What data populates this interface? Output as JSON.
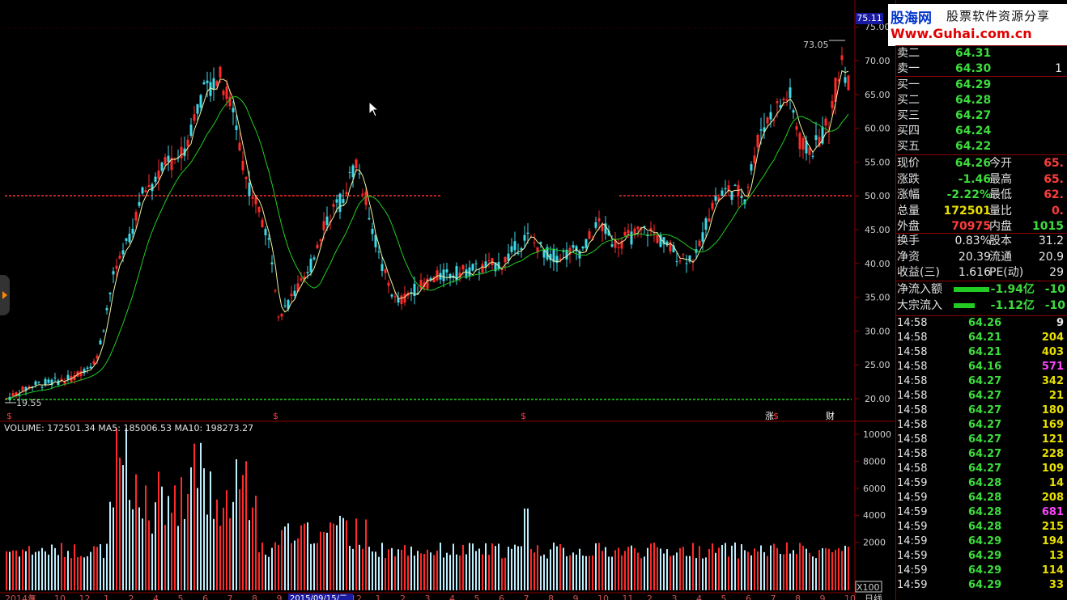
{
  "brand": {
    "logo": "股海网",
    "tagline": "股票软件资源分享",
    "url": "Www.Guhai.com.cn"
  },
  "price_tag": "75.11",
  "chart": {
    "high_label": "73.05",
    "low_label": "19.55",
    "markers": [
      "$",
      "$",
      "$",
      "涨",
      "$",
      "财"
    ],
    "y_labels": [
      "75.00",
      "70.00",
      "65.00",
      "60.00",
      "55.00",
      "50.00",
      "45.00",
      "40.00",
      "35.00",
      "30.00",
      "25.00",
      "20.00"
    ],
    "vol_labels": [
      "10000",
      "8000",
      "6000",
      "4000",
      "2000"
    ],
    "vol_unit": "X100",
    "date_tag": "2015/09/15/二",
    "period_tag": "日线",
    "x_labels": [
      "2014年",
      "9",
      "10",
      "12",
      "1",
      "2",
      "4",
      "5",
      "6",
      "7",
      "8",
      "9",
      "10",
      "11",
      "12",
      "1",
      "2",
      "3",
      "4",
      "5",
      "6",
      "7",
      "8",
      "9",
      "10",
      "11",
      "2",
      "3",
      "4",
      "5",
      "6",
      "7",
      "8",
      "9",
      "10"
    ],
    "colors": {
      "up": "#ff2a2a",
      "down": "#3fd9e8",
      "ma5": "#f0f0a0",
      "ma_long": "#22cc22",
      "ref_line": "#ff2a2a",
      "low_line": "#22cc22"
    }
  },
  "volume_header": {
    "volume": "VOLUME: 172501.34",
    "ma5": "MA5: 185006.53",
    "ma10": "MA10: 198273.27"
  },
  "quote": {
    "asks": [
      {
        "label": "卖二",
        "price": "64.31",
        "vol": ""
      },
      {
        "label": "卖一",
        "price": "64.30",
        "vol": "1"
      }
    ],
    "bids": [
      {
        "label": "买一",
        "price": "64.29"
      },
      {
        "label": "买二",
        "price": "64.28"
      },
      {
        "label": "买三",
        "price": "64.27"
      },
      {
        "label": "买四",
        "price": "64.24"
      },
      {
        "label": "买五",
        "price": "64.22"
      }
    ],
    "stats": [
      {
        "l1": "现价",
        "v1": "64.26",
        "l2": "今开",
        "v2": "65."
      },
      {
        "l1": "涨跌",
        "v1": "-1.46",
        "l2": "最高",
        "v2": "65."
      },
      {
        "l1": "涨幅",
        "v1": "-2.22%",
        "l2": "最低",
        "v2": "62."
      },
      {
        "l1": "总量",
        "v1": "172501",
        "l2": "量比",
        "v2": "0."
      },
      {
        "l1": "外盘",
        "v1": "70975",
        "l2": "内盘",
        "v2": "1015"
      }
    ],
    "stats2": [
      {
        "l1": "换手",
        "v1": "0.83%",
        "l2": "股本",
        "v2": "31.2"
      },
      {
        "l1": "净资",
        "v1": "20.39",
        "l2": "流通",
        "v2": "20.9"
      },
      {
        "l1": "收益(三)",
        "v1": "1.616",
        "l2": "PE(动)",
        "v2": "29"
      }
    ],
    "flows": [
      {
        "label": "净流入额",
        "value": "-1.94亿",
        "extra": "-10"
      },
      {
        "label": "大宗流入",
        "value": "-1.12亿",
        "extra": "-10"
      }
    ]
  },
  "ticks": [
    {
      "time": "14:58",
      "price": "64.26",
      "vol": "9",
      "color": "white"
    },
    {
      "time": "14:58",
      "price": "64.21",
      "vol": "204",
      "color": "yellow"
    },
    {
      "time": "14:58",
      "price": "64.21",
      "vol": "403",
      "color": "yellow"
    },
    {
      "time": "14:58",
      "price": "64.16",
      "vol": "571",
      "color": "purple"
    },
    {
      "time": "14:58",
      "price": "64.27",
      "vol": "342",
      "color": "yellow"
    },
    {
      "time": "14:58",
      "price": "64.27",
      "vol": "21",
      "color": "yellow"
    },
    {
      "time": "14:58",
      "price": "64.27",
      "vol": "180",
      "color": "yellow"
    },
    {
      "time": "14:58",
      "price": "64.27",
      "vol": "169",
      "color": "yellow"
    },
    {
      "time": "14:58",
      "price": "64.27",
      "vol": "121",
      "color": "yellow"
    },
    {
      "time": "14:58",
      "price": "64.27",
      "vol": "228",
      "color": "yellow"
    },
    {
      "time": "14:58",
      "price": "64.27",
      "vol": "109",
      "color": "yellow"
    },
    {
      "time": "14:59",
      "price": "64.28",
      "vol": "14",
      "color": "yellow"
    },
    {
      "time": "14:59",
      "price": "64.28",
      "vol": "208",
      "color": "yellow"
    },
    {
      "time": "14:59",
      "price": "64.28",
      "vol": "681",
      "color": "purple"
    },
    {
      "time": "14:59",
      "price": "64.28",
      "vol": "215",
      "color": "yellow"
    },
    {
      "time": "14:59",
      "price": "64.29",
      "vol": "194",
      "color": "yellow"
    },
    {
      "time": "14:59",
      "price": "64.29",
      "vol": "13",
      "color": "yellow"
    },
    {
      "time": "14:59",
      "price": "64.29",
      "vol": "114",
      "color": "yellow"
    },
    {
      "time": "14:59",
      "price": "64.29",
      "vol": "33",
      "color": "yellow"
    }
  ]
}
